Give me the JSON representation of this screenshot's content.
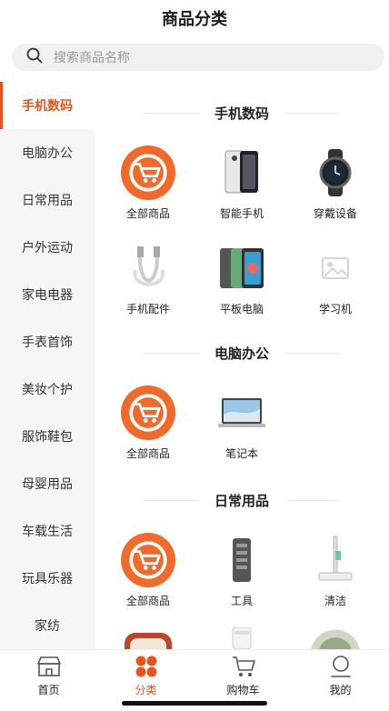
{
  "header": {
    "title": "商品分类"
  },
  "search": {
    "placeholder": "搜索商品名称"
  },
  "sidebar": {
    "items": [
      {
        "label": "手机数码",
        "active": true
      },
      {
        "label": "电脑办公"
      },
      {
        "label": "日常用品"
      },
      {
        "label": "户外运动"
      },
      {
        "label": "家电电器"
      },
      {
        "label": "手表首饰"
      },
      {
        "label": "美妆个护"
      },
      {
        "label": "服饰鞋包"
      },
      {
        "label": "母婴用品"
      },
      {
        "label": "车载生活"
      },
      {
        "label": "玩具乐器"
      },
      {
        "label": "家纺"
      }
    ]
  },
  "sections": [
    {
      "title": "手机数码",
      "items": [
        {
          "label": "全部商品",
          "icon": "all-goods-icon"
        },
        {
          "label": "智能手机",
          "icon": "smartphone-image"
        },
        {
          "label": "穿戴设备",
          "icon": "smartwatch-image"
        },
        {
          "label": "手机配件",
          "icon": "cable-image"
        },
        {
          "label": "平板电脑",
          "icon": "tablet-image"
        },
        {
          "label": "学习机",
          "icon": "placeholder-image"
        }
      ]
    },
    {
      "title": "电脑办公",
      "items": [
        {
          "label": "全部商品",
          "icon": "all-goods-icon"
        },
        {
          "label": "笔记本",
          "icon": "laptop-image"
        }
      ]
    },
    {
      "title": "日常用品",
      "items": [
        {
          "label": "全部商品",
          "icon": "all-goods-icon"
        },
        {
          "label": "工具",
          "icon": "toolkit-image"
        },
        {
          "label": "清洁",
          "icon": "mop-image"
        }
      ]
    }
  ],
  "tabbar": {
    "items": [
      {
        "label": "首页",
        "icon": "home-icon"
      },
      {
        "label": "分类",
        "icon": "category-icon",
        "active": true
      },
      {
        "label": "购物车",
        "icon": "cart-icon"
      },
      {
        "label": "我的",
        "icon": "profile-icon"
      }
    ]
  },
  "colors": {
    "accent": "#e8541e",
    "badge": "#f26a2b",
    "sidebar_bg": "#f6f6f6"
  }
}
